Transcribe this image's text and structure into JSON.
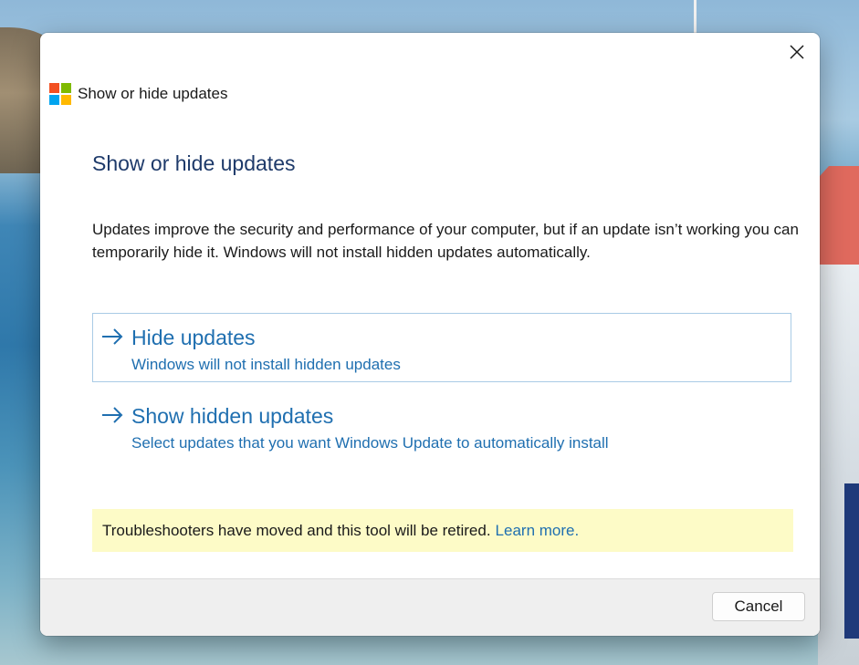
{
  "window": {
    "title": "Show or hide updates",
    "app_icon": "windows-logo-icon",
    "close_icon": "close-icon"
  },
  "content": {
    "heading": "Show or hide updates",
    "description": "Updates improve the security and performance of your computer, but if an update isn’t working you can temporarily hide it. Windows will not install hidden updates automatically."
  },
  "options": [
    {
      "icon": "arrow-right-icon",
      "title": "Hide updates",
      "subtitle": "Windows will not install hidden updates",
      "focused": true
    },
    {
      "icon": "arrow-right-icon",
      "title": "Show hidden updates",
      "subtitle": "Select updates that you want Windows Update to automatically install",
      "focused": false
    }
  ],
  "notice": {
    "text": "Troubleshooters have moved and this tool will be retired.",
    "link": "Learn more."
  },
  "footer": {
    "cancel_label": "Cancel"
  },
  "colors": {
    "accent": "#1f6fb0",
    "heading": "#1e3a6a",
    "notice_bg": "#fdfbc7",
    "footer_bg": "#efefef",
    "logo_red": "#f25022",
    "logo_green": "#7fba00",
    "logo_blue": "#00a4ef",
    "logo_yellow": "#ffb900"
  }
}
